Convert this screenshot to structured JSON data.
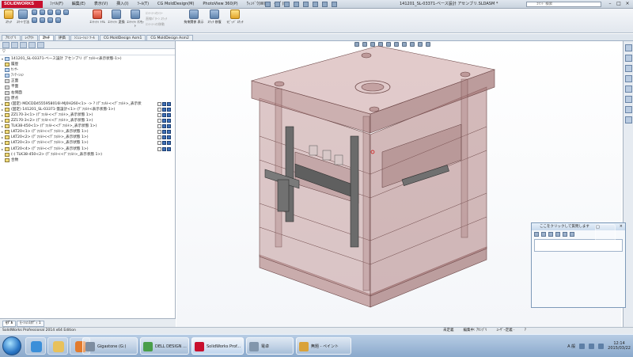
{
  "app": {
    "logo_text": "SOLIDWORKS",
    "document_title": "141201_SL-03371-ベース設計 アセンブリ.SLDASM *",
    "search_placeholder": "ｺﾏﾝﾄﾞ検索"
  },
  "menu": [
    "ﾌｧｲﾙ(F)",
    "編集(E)",
    "表示(V)",
    "挿入(I)",
    "ﾂｰﾙ(T)",
    "CG MoldDesign(M)",
    "PhotoView 360(P)",
    "ｳｨﾝﾄﾞｳ(W)",
    "ﾍﾙﾌﾟ(H)"
  ],
  "commands": {
    "sketch": "ｽｹｯﾁ",
    "smart_dim": "ｽﾏｰﾄ寸法",
    "trim": "ｴﾝﾃｨﾃｨ ﾄﾘﾑ",
    "convert": "ｴﾝﾃｨﾃｨ 変換",
    "offset": "ｴﾝﾃｨﾃｨ ｵﾌｾｯﾄ",
    "mirror": "ｴﾝﾃｨﾃｨのﾐﾗｰ",
    "linear_pattern": "直線ﾊﾟﾀｰﾝ ｽｹｯﾁ",
    "move": "ｴﾝﾃｨﾃｨの移動",
    "relations": "拘束関係 表示",
    "repair": "ｽｹｯﾁ 修復",
    "rapid": "ﾗﾋﾟｯﾄﾞ ｽｹｯﾁ"
  },
  "tabs": [
    "ｱｾﾝﾌﾞﾘ",
    "ﾚｲｱｳﾄ",
    "ｽｹｯﾁ",
    "評価",
    "ｼﾐｭﾚｰｼｮﾝ ﾂｰﾙ",
    "CG MoldDesign Asm1",
    "CG MoldDesign Asm2"
  ],
  "active_tab": "ｽｹｯﾁ",
  "tree": {
    "filter": "▽",
    "root": "141201_SL-03371-ベース設計 アセンブリ (ﾃﾞﾌｫﾙﾄ<表示状態-1>)",
    "items": [
      {
        "label": "履歴",
        "icon": "folder-icon"
      },
      {
        "label": "ｾﾝｻｰ",
        "icon": "sensor-icon"
      },
      {
        "label": "ｱﾉﾃｰｼｮﾝ",
        "icon": "annotation-icon"
      },
      {
        "label": "正面",
        "icon": "plane-icon"
      },
      {
        "label": "平面",
        "icon": "plane-icon"
      },
      {
        "label": "右側面",
        "icon": "plane-icon"
      },
      {
        "label": "原点",
        "icon": "origin-icon"
      },
      {
        "label": "(固定) MDCDD4555958016I-MJ0H260<1> -> ? (ﾃﾞﾌｫﾙﾄ<<ﾃﾞﾌｫﾙﾄ>_表示状",
        "icon": "part-icon",
        "markers": true
      },
      {
        "label": "(固定) 141201_SL-03371-蓋設計<1> (ﾃﾞﾌｫﾙﾄ<表示状態-1>)",
        "icon": "part-icon",
        "markers": true
      },
      {
        "label": "ZZ170-3<1> (ﾃﾞﾌｫﾙﾄ<<ﾃﾞﾌｫﾙﾄ>_表示状態 1>)",
        "icon": "part-icon",
        "markers": true
      },
      {
        "label": "ZZ170-3<2> (ﾃﾞﾌｫﾙﾄ<<ﾃﾞﾌｫﾙﾄ>_表示状態 1>)",
        "icon": "part-icon",
        "markers": true
      },
      {
        "label": "TLK38-450<1> (ﾃﾞﾌｫﾙﾄ<<ﾃﾞﾌｫﾙﾄ>_表示状態 1>)",
        "icon": "part-icon",
        "markers": true
      },
      {
        "label": "LKT20<1> (ﾃﾞﾌｫﾙﾄ<<ﾃﾞﾌｫﾙﾄ>_表示状態 1>)",
        "icon": "part-icon",
        "markers": true
      },
      {
        "label": "LKT20<2> (ﾃﾞﾌｫﾙﾄ<<ﾃﾞﾌｫﾙﾄ>_表示状態 1>)",
        "icon": "part-icon",
        "markers": true
      },
      {
        "label": "LKT20<3> (ﾃﾞﾌｫﾙﾄ<<ﾃﾞﾌｫﾙﾄ>_表示状態 1>)",
        "icon": "part-icon",
        "markers": true
      },
      {
        "label": "LKT20<4> (ﾃﾞﾌｫﾙﾄ<<ﾃﾞﾌｫﾙﾄ>_表示状態 1>)",
        "icon": "part-icon",
        "markers": true
      },
      {
        "label": "(-) TLK38-450<2> (ﾃﾞﾌｫﾙﾄ<<ﾃﾞﾌｫﾙﾄ>_表示状態 1>)",
        "icon": "part-icon",
        "markers": false
      },
      {
        "label": "合致",
        "icon": "mates-icon"
      }
    ]
  },
  "fm_bottom_tabs": [
    "ﾓﾃﾞﾙ",
    "ﾓｰｼｮﾝｽﾀﾃﾞｨ 1"
  ],
  "feedback": {
    "title": "ここをクリックして質問します",
    "pin": "□",
    "close": "×"
  },
  "statusbar": {
    "left": "SolidWorks Professional 2014 x64 Edition",
    "right": [
      "未定義",
      "編集中: ｱｾﾝﾌﾞﾘ",
      "ﾕｰｻﾞｰ定義 ·",
      "?"
    ]
  },
  "taskbar": {
    "items": [
      {
        "label": "Gigastone (G:)",
        "active": false
      },
      {
        "label": "DELL DESIGN ...",
        "active": false
      },
      {
        "label": "SolidWorks Prof...",
        "active": true
      },
      {
        "label": "電卓",
        "active": false
      },
      {
        "label": "無題 - ペイント",
        "active": false
      }
    ],
    "time": "12:14",
    "date": "2015/03/22",
    "lang": "A 般"
  },
  "colors": {
    "mold": "#b88e8e",
    "mold_dark": "#8a6262",
    "accent": "#c8102e"
  }
}
